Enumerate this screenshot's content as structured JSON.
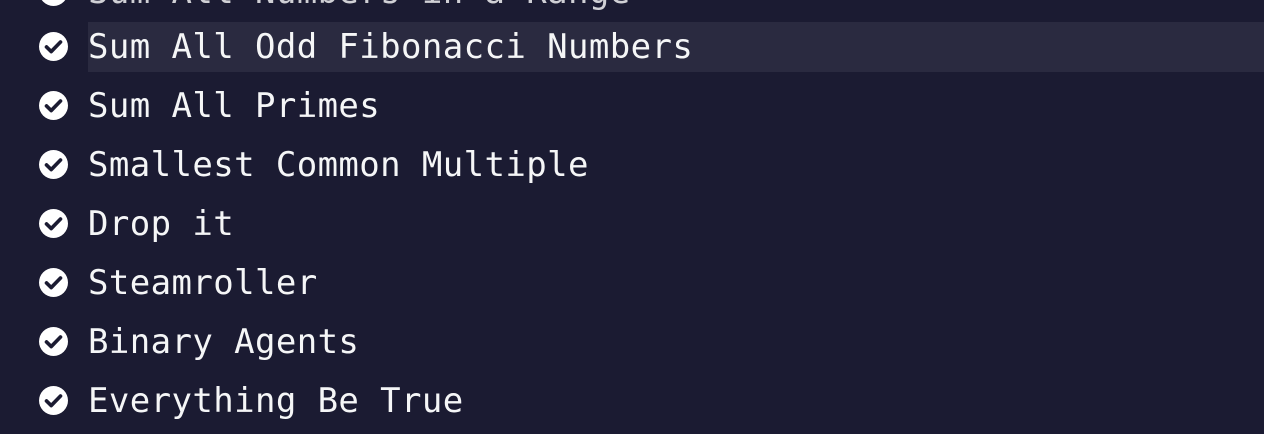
{
  "challenges": [
    {
      "label": "Sum All Numbers in a Range",
      "completed": true,
      "icon": "check-circle-icon",
      "partial": true
    },
    {
      "label": "Sum All Odd Fibonacci Numbers",
      "completed": true,
      "icon": "check-circle-icon",
      "active": true
    },
    {
      "label": "Sum All Primes",
      "completed": true,
      "icon": "check-circle-icon"
    },
    {
      "label": "Smallest Common Multiple",
      "completed": true,
      "icon": "check-circle-icon"
    },
    {
      "label": "Drop it",
      "completed": true,
      "icon": "check-circle-icon"
    },
    {
      "label": "Steamroller",
      "completed": true,
      "icon": "check-circle-icon"
    },
    {
      "label": "Binary Agents",
      "completed": true,
      "icon": "check-circle-icon"
    },
    {
      "label": "Everything Be True",
      "completed": true,
      "icon": "check-circle-icon"
    }
  ],
  "colors": {
    "background": "#1b1b32",
    "highlight": "#2a2a40",
    "text": "#f5f6f7",
    "check": "#ffffff"
  }
}
